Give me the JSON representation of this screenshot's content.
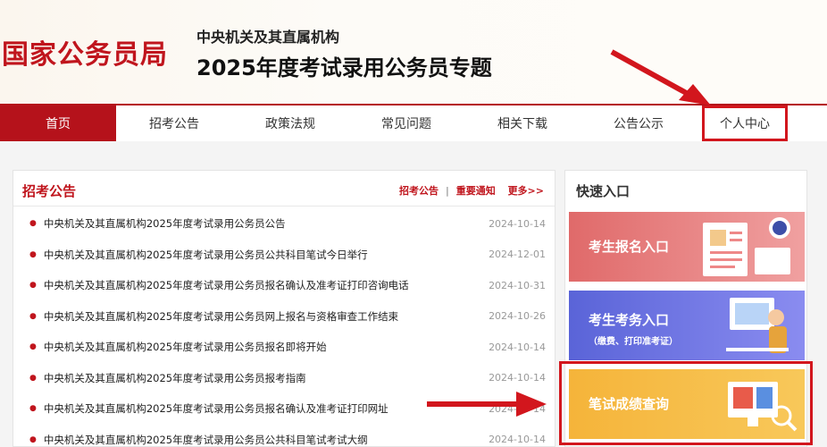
{
  "header": {
    "logo": "国家公务员局",
    "subtitle1": "中央机关及其直属机构",
    "subtitle2": "2025年度考试录用公务员专题"
  },
  "nav": {
    "items": [
      {
        "label": "首页"
      },
      {
        "label": "招考公告"
      },
      {
        "label": "政策法规"
      },
      {
        "label": "常见问题"
      },
      {
        "label": "相关下载"
      },
      {
        "label": "公告公示"
      },
      {
        "label": "个人中心"
      }
    ]
  },
  "announcements": {
    "title": "招考公告",
    "link1": "招考公告",
    "divider": "|",
    "link2": "重要通知",
    "more": "更多>>",
    "items": [
      {
        "title": "中央机关及其直属机构2025年度考试录用公务员公告",
        "date": "2024-10-14"
      },
      {
        "title": "中央机关及其直属机构2025年度考试录用公务员公共科目笔试今日举行",
        "date": "2024-12-01"
      },
      {
        "title": "中央机关及其直属机构2025年度考试录用公务员报名确认及准考证打印咨询电话",
        "date": "2024-10-31"
      },
      {
        "title": "中央机关及其直属机构2025年度考试录用公务员网上报名与资格审查工作结束",
        "date": "2024-10-26"
      },
      {
        "title": "中央机关及其直属机构2025年度考试录用公务员报名即将开始",
        "date": "2024-10-14"
      },
      {
        "title": "中央机关及其直属机构2025年度考试录用公务员报考指南",
        "date": "2024-10-14"
      },
      {
        "title": "中央机关及其直属机构2025年度考试录用公务员报名确认及准考证打印网址",
        "date": "2024-10-14"
      },
      {
        "title": "中央机关及其直属机构2025年度考试录用公务员公共科目笔试考试大纲",
        "date": "2024-10-14"
      }
    ]
  },
  "quick": {
    "title": "快速入口",
    "card1": "考生报名入口",
    "card2": "考生考务入口",
    "card2_sub": "（缴费、打印准考证）",
    "card3": "笔试成绩查询"
  },
  "colors": {
    "brand": "#c0151d",
    "nav_active": "#b5121b",
    "card1": "#e06a6a",
    "card2": "#5a64d8",
    "card3": "#f5b43a"
  }
}
